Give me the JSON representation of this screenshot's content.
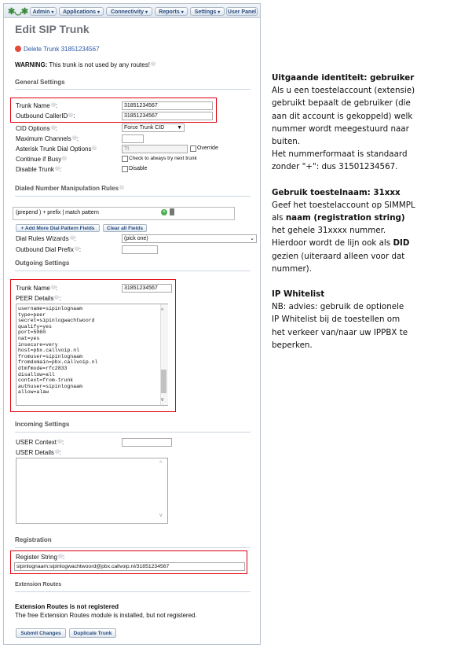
{
  "menu": {
    "items": [
      "Admin",
      "Applications",
      "Connectivity",
      "Reports",
      "Settings",
      "User Panel"
    ]
  },
  "page": {
    "title": "Edit SIP Trunk",
    "delete_link": "Delete Trunk 31851234567",
    "warning_bold": "WARNING:",
    "warning_text": " This trunk is not used by any routes!"
  },
  "general": {
    "heading": "General Settings",
    "trunk_name_label": "Trunk Name",
    "trunk_name_value": "31851234567",
    "outbound_callerid_label": "Outbound CallerID",
    "outbound_callerid_value": "31851234567",
    "cid_options_label": "CID Options",
    "cid_options_value": "Force Trunk CID",
    "max_channels_label": "Maximum Channels",
    "dial_options_label": "Asterisk Trunk Dial Options",
    "dial_options_value": "Tt",
    "override_label": "Override",
    "continue_busy_label": "Continue if Busy",
    "continue_busy_check": "Check to always try next trunk",
    "disable_trunk_label": "Disable Trunk",
    "disable_label": "Disable"
  },
  "dialed": {
    "heading": "Dialed Number Manipulation Rules",
    "rule_text": "(prepend        ) + prefix      | match pattern",
    "add_more_button": "+ Add More Dial Pattern Fields",
    "clear_all_button": "Clear all Fields",
    "wizards_label": "Dial Rules Wizards",
    "wizards_value": "(pick one)",
    "outbound_prefix_label": "Outbound Dial Prefix"
  },
  "outgoing": {
    "heading": "Outgoing Settings",
    "trunk_name_label": "Trunk Name",
    "trunk_name_value": "31851234567",
    "peer_details_label": "PEER Details",
    "peer_lines": [
      "username=sipinlognaam",
      "type=peer",
      "secret=sipinlogwachtwoord",
      "qualify=yes",
      "port=5060",
      "nat=yes",
      "insecure=very",
      "host=pbx.callvoip.nl",
      "fromuser=sipinlognaam",
      "fromdomain=pbx.callvoip.nl",
      "dtmfmode=rfc2833",
      "disallow=all",
      "context=from-trunk",
      "authuser=sipinlognaam",
      "allow=alaw"
    ]
  },
  "incoming": {
    "heading": "Incoming Settings",
    "user_context_label": "USER Context",
    "user_details_label": "USER Details"
  },
  "registration": {
    "heading": "Registration",
    "register_string_label": "Register String",
    "register_string_value": "sipinlognaam:sipinlogwachtwoord@pbx.callvoip.nl/31851234567"
  },
  "extension": {
    "heading": "Extension Routes",
    "not_registered_title": "Extension Routes is not registered",
    "not_registered_text": "The free Extension Routes module is installed, but not registered."
  },
  "actions": {
    "submit": "Submit Changes",
    "duplicate": "Duplicate Trunk"
  },
  "notes": {
    "s1_title": "Uitgaande identiteit: gebruiker",
    "s1_lines": [
      "Als u een toestelaccount (extensie)",
      "gebruikt bepaalt de gebruiker (die",
      "aan dit account is gekoppeld) welk",
      "nummer wordt meegestuurd naar",
      "buiten.",
      "Het nummerformaat is standaard",
      "zonder \"+\": dus 31501234567."
    ],
    "s2_title": "Gebruik toestelnaam: 31xxx",
    "s2_line1": "Geef het toestelaccount op SIMMPL",
    "s2_line2_pre": "als ",
    "s2_line2_bold": "naam (registration string)",
    "s2_line3": "het gehele 31xxxx nummer.",
    "s2_line4_pre": "Hierdoor wordt de lijn ook als ",
    "s2_line4_bold": "DID",
    "s2_line5": "gezien (uiteraard alleen voor dat",
    "s2_line6": "nummer).",
    "s3_title": "IP Whitelist",
    "s3_lines": [
      "NB: advies: gebruik de optionele",
      "IP Whitelist bij de toestellen om",
      "het verkeer van/naar uw IPPBX te",
      "beperken."
    ]
  },
  "colors": {
    "highlight_border": "#e0000f",
    "link": "#2a59a8",
    "menu_text": "#2b4c7e"
  }
}
